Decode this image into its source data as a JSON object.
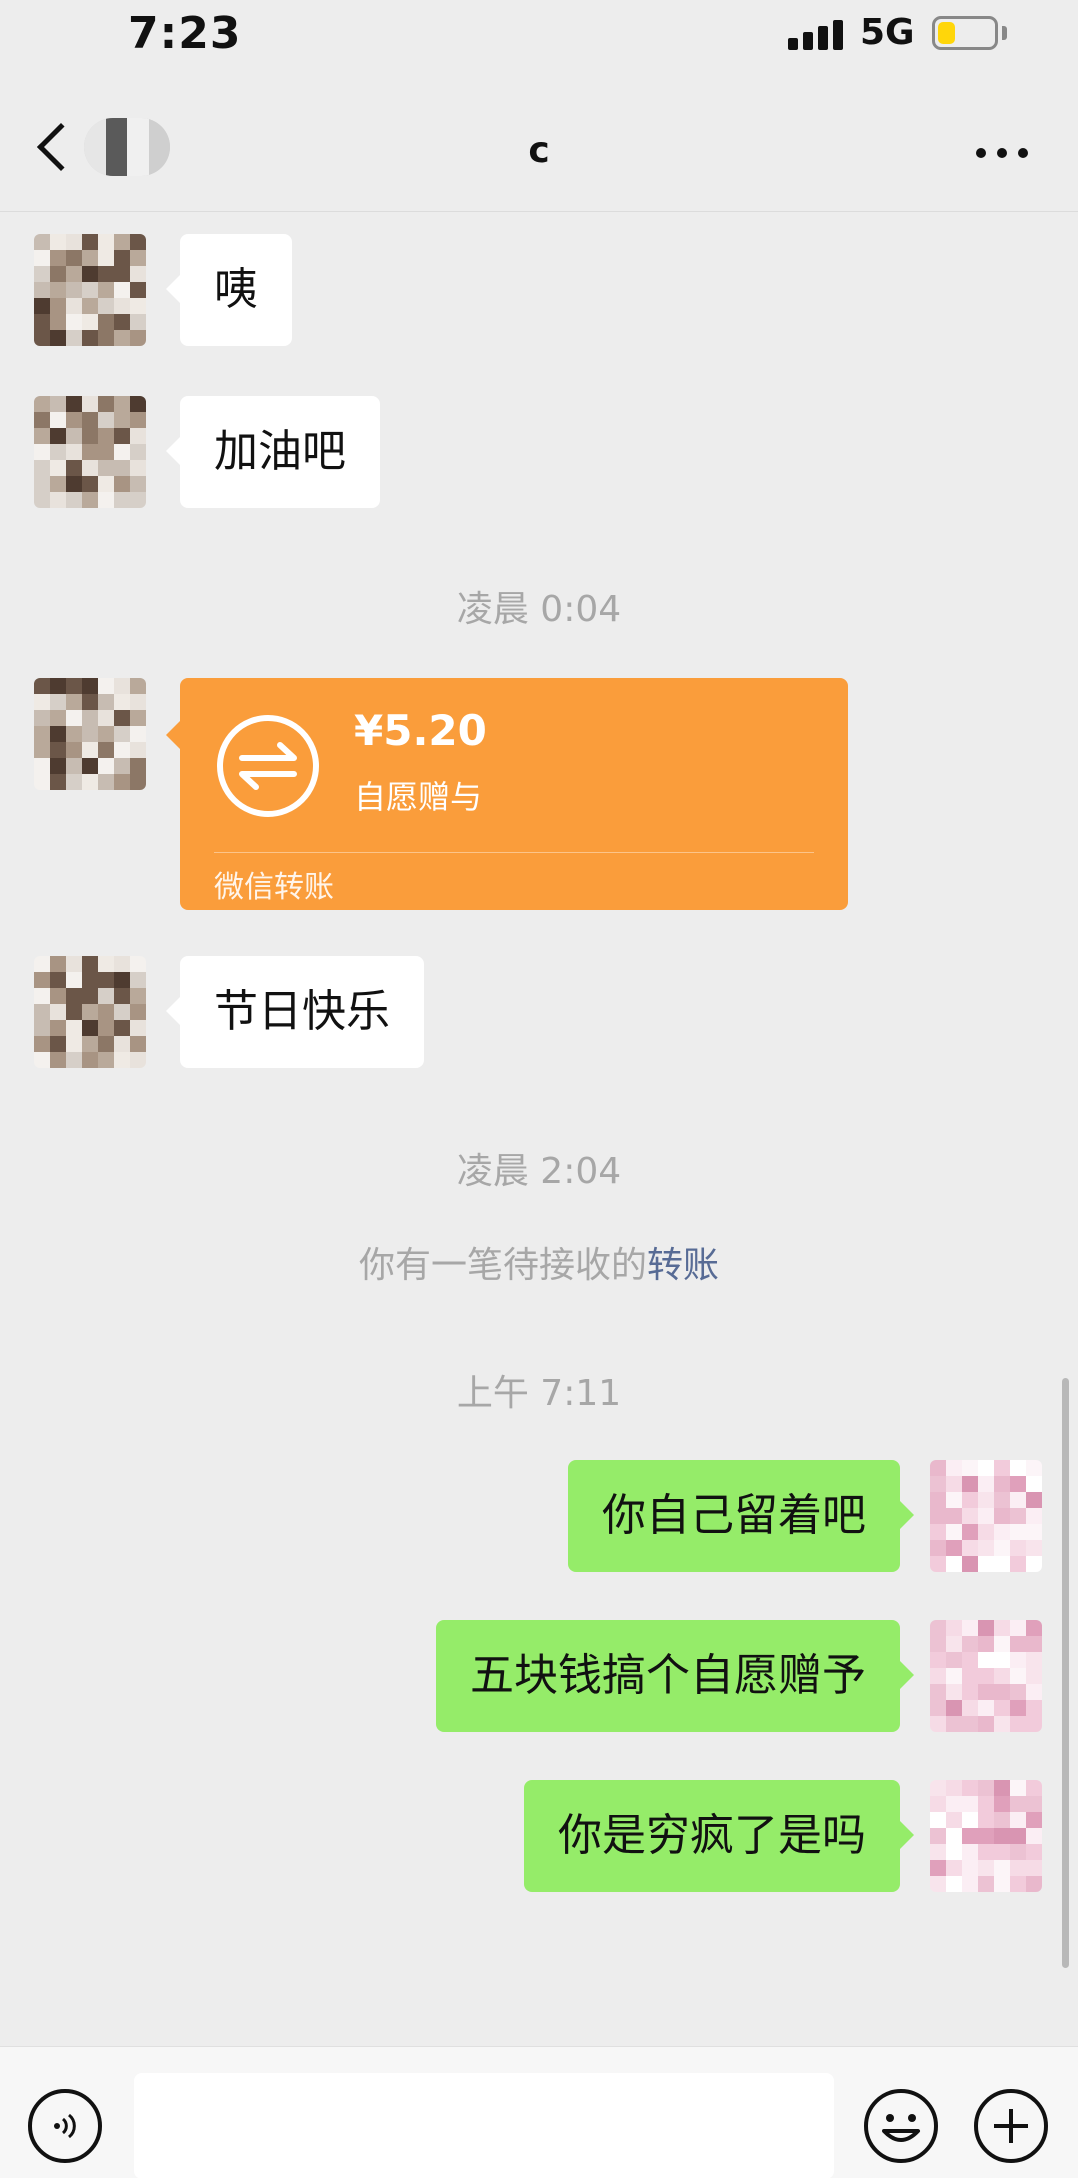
{
  "status_bar": {
    "time": "7:23",
    "network": "5G",
    "battery_level": 0.3,
    "battery_color": "#ffd60a",
    "icons": [
      "signal-icon",
      "battery-icon"
    ]
  },
  "nav": {
    "title": "c",
    "icons": [
      "back-icon",
      "more-icon"
    ]
  },
  "messages": [
    {
      "type": "text",
      "direction": "in",
      "text": "咦"
    },
    {
      "type": "text",
      "direction": "in",
      "text": "加油吧"
    },
    {
      "type": "timestamp",
      "text": "凌晨 0:04"
    },
    {
      "type": "transfer",
      "direction": "in",
      "amount": "¥5.20",
      "note": "自愿赠与",
      "footer": "微信转账"
    },
    {
      "type": "text",
      "direction": "in",
      "text": "节日快乐"
    },
    {
      "type": "timestamp",
      "text": "凌晨 2:04"
    },
    {
      "type": "system",
      "prefix": "你有一笔待接收的",
      "link": "转账"
    },
    {
      "type": "timestamp",
      "text": "上午 7:11"
    },
    {
      "type": "text",
      "direction": "out",
      "text": "你自己留着吧"
    },
    {
      "type": "text",
      "direction": "out",
      "text": "五块钱搞个自愿赠予"
    },
    {
      "type": "text",
      "direction": "out",
      "text": "你是穷疯了是吗"
    }
  ],
  "input_bar": {
    "placeholder": "",
    "icons": [
      "voice-icon",
      "emoji-icon",
      "plus-icon"
    ]
  },
  "colors": {
    "background": "#ededed",
    "incoming_bubble": "#ffffff",
    "outgoing_bubble": "#95ec69",
    "transfer_card": "#fa9d3b",
    "link": "#576b95",
    "timestamp": "#a7a7a7"
  }
}
